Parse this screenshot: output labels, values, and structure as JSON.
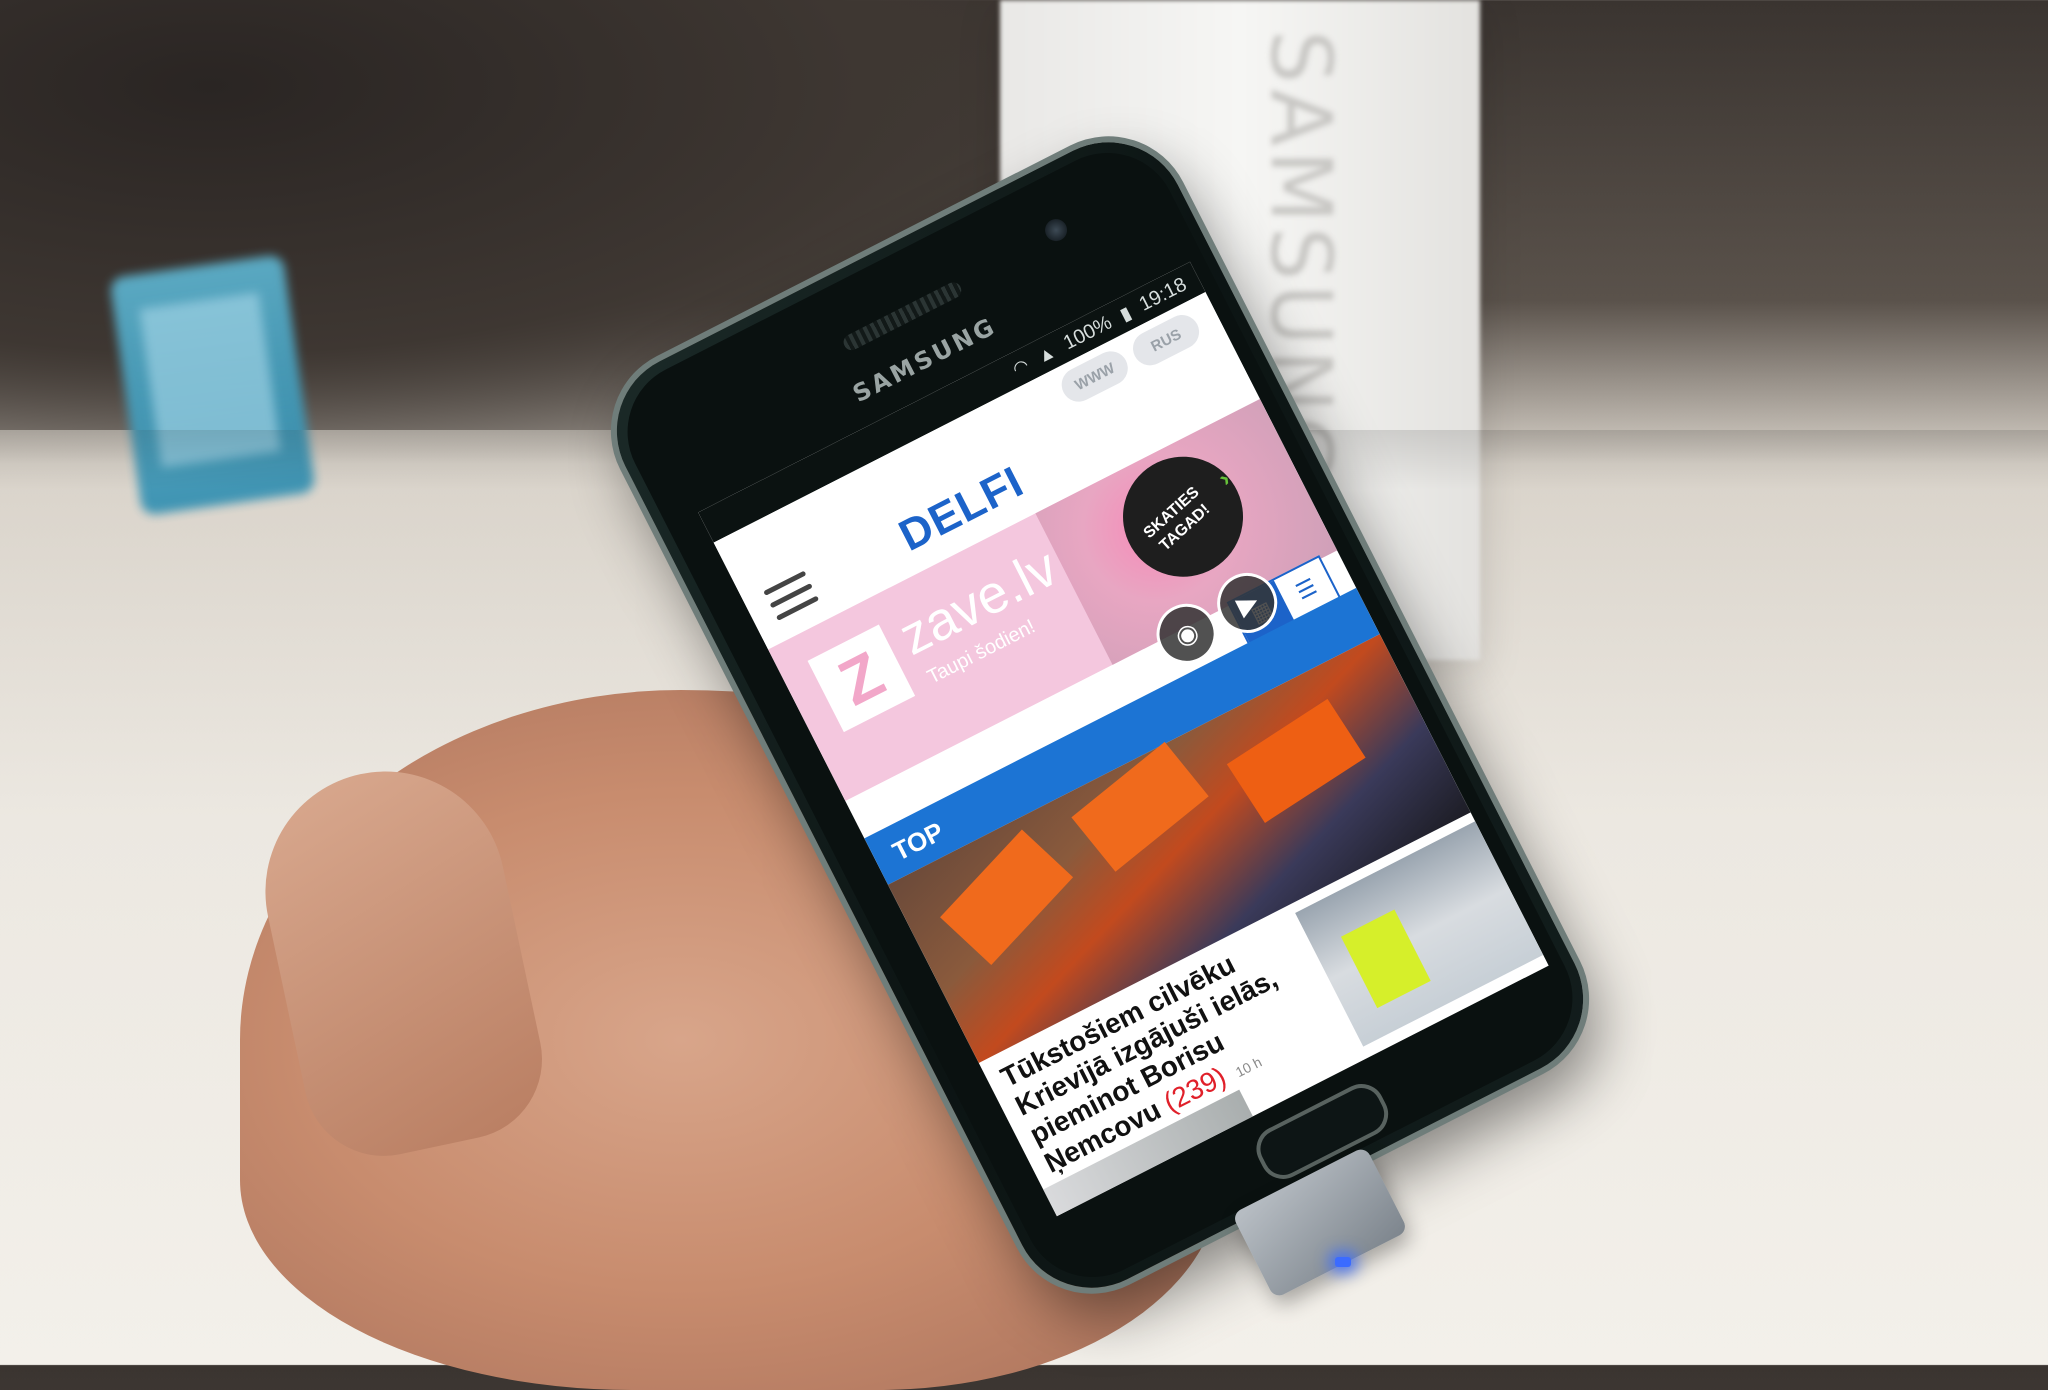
{
  "status_bar": {
    "battery": "100%",
    "time": "19:18"
  },
  "phone": {
    "brand": "SAMSUNG"
  },
  "site": {
    "logo_prefix": "DE",
    "logo_suffix": "LFI",
    "lang_links": [
      "WWW",
      "RUS"
    ]
  },
  "ad": {
    "logo_letter": "Z",
    "title": "zave.lv",
    "subtitle": "Taupi šodien!",
    "badge_text": "SKATIES TAGAD!"
  },
  "section": {
    "label": "TOP"
  },
  "article": {
    "headline": "Tūkstošiem cilvēku Krievijā izgājuši ielās, pieminot Borisu Ņemcovu",
    "comment_count": "(239)",
    "time_ago": "10 h"
  },
  "background": {
    "box_text": "SAMSUNG"
  },
  "colors": {
    "accent": "#1c74d4",
    "logo_blue": "#1c63c9",
    "logo_yellow": "#f5b800",
    "comment_red": "#e0202a",
    "ad_pink": "#f4c7de"
  }
}
